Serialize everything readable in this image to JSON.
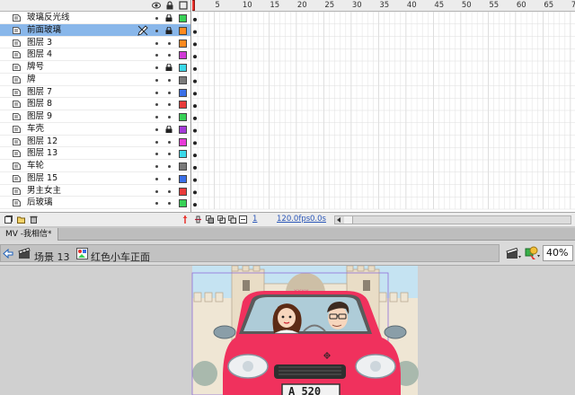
{
  "layers": [
    {
      "name": "玻璃反光线",
      "color": "#38d156",
      "locked": true,
      "selected": false
    },
    {
      "name": "前面玻璃",
      "color": "#ff8a1f",
      "locked": true,
      "selected": true
    },
    {
      "name": "图层 3",
      "color": "#ff8a1f",
      "locked": false,
      "selected": false
    },
    {
      "name": "图层 4",
      "color": "#d03ad6",
      "locked": false,
      "selected": false
    },
    {
      "name": "牌号",
      "color": "#3ad8e8",
      "locked": true,
      "selected": false
    },
    {
      "name": "牌",
      "color": "#7a7a7a",
      "locked": false,
      "selected": false
    },
    {
      "name": "图层 7",
      "color": "#3a6fe8",
      "locked": false,
      "selected": false
    },
    {
      "name": "图层 8",
      "color": "#e83a3a",
      "locked": false,
      "selected": false
    },
    {
      "name": "图层 9",
      "color": "#38d156",
      "locked": false,
      "selected": false
    },
    {
      "name": "车壳",
      "color": "#a43ad8",
      "locked": true,
      "selected": false
    },
    {
      "name": "图层 12",
      "color": "#e83ad8",
      "locked": false,
      "selected": false
    },
    {
      "name": "图层 13",
      "color": "#3ad8e8",
      "locked": false,
      "selected": false
    },
    {
      "name": "车轮",
      "color": "#7a7a7a",
      "locked": false,
      "selected": false
    },
    {
      "name": "图层 15",
      "color": "#3a6fe8",
      "locked": false,
      "selected": false
    },
    {
      "name": "男主女主",
      "color": "#e83a3a",
      "locked": false,
      "selected": false
    },
    {
      "name": "后玻璃",
      "color": "#38d156",
      "locked": false,
      "selected": false
    }
  ],
  "ruler": {
    "labels": [
      "5",
      "10",
      "15",
      "20",
      "25",
      "30",
      "35",
      "40",
      "45",
      "50",
      "55",
      "60",
      "65",
      "70"
    ],
    "playhead_frame": "1"
  },
  "footer": {
    "current_frame": "1",
    "fps": "120.0fps",
    "time": "0.0s"
  },
  "document": {
    "tab_label": "MV -我相信*"
  },
  "edit_bar": {
    "scene": "场景 13",
    "symbol": "红色小车正面",
    "zoom": "40%"
  },
  "stage_art": {
    "plate_text": "A 520",
    "car_color": "#f0315d",
    "sky_color": "#c5e3f2"
  },
  "colors": {
    "selection": "#89b7ea",
    "playhead": "#e8322c",
    "link": "#2a56b8"
  }
}
